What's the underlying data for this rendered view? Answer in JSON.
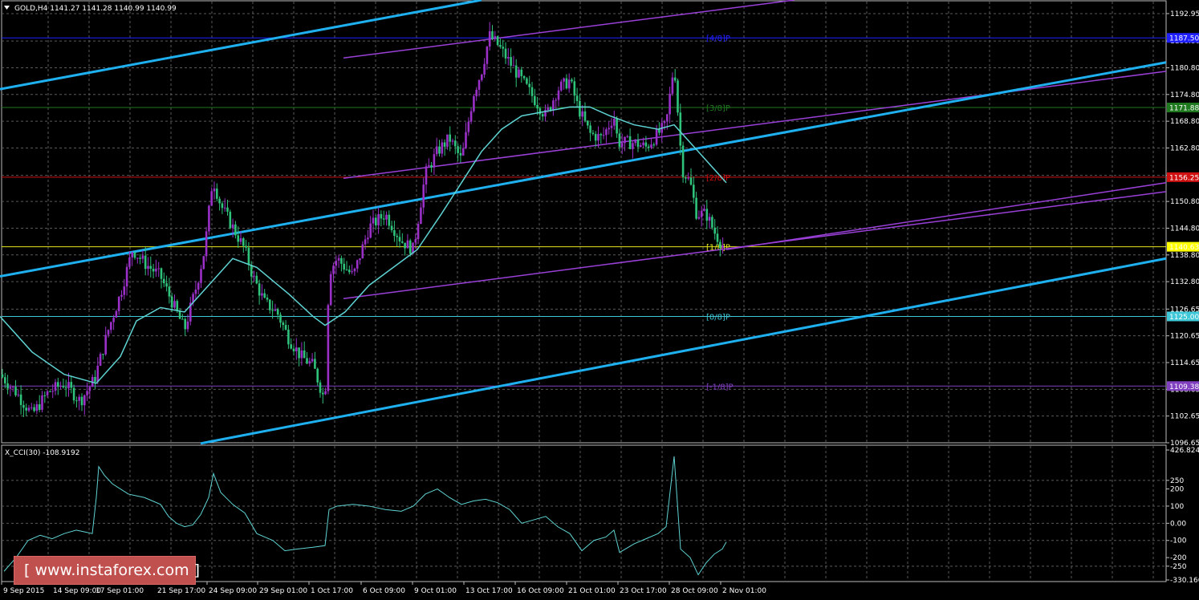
{
  "header": {
    "symbol_label": "GOLD,H4  1141.27 1141.28 1140.99 1140.99"
  },
  "indicator": {
    "label": "X_CCI(30) -108.9192"
  },
  "watermark": {
    "text": "[  www.instaforex.com ]"
  },
  "colors": {
    "background": "#000000",
    "grid": "#5a5a5a",
    "bull": "#9a30c8",
    "bear": "#2ec27a",
    "ma": "#5fd3d3",
    "channel": "#1fb0f0",
    "purple_line": "#9a40d8",
    "cci": "#5fd3d3",
    "watermark_bg": "#c0504d"
  },
  "chart_data": [
    {
      "type": "candlestick",
      "title": "GOLD,H4",
      "ylim": [
        1096.65,
        1196.0
      ],
      "y_ticks": [
        "1192.95",
        "1186.80",
        "1180.80",
        "1174.80",
        "1168.80",
        "1162.80",
        "1156.65",
        "1150.80",
        "1144.80",
        "1138.80",
        "1132.80",
        "1126.65",
        "1120.65",
        "1114.65",
        "1108.65",
        "1102.65",
        "1096.65"
      ],
      "x_tick_labels": [
        "9 Sep 2015",
        "14 Sep 09:00",
        "17 Sep 01:00",
        "21 Sep 17:00",
        "24 Sep 09:00",
        "29 Sep 01:00",
        "1 Oct 17:00",
        "6 Oct 09:00",
        "9 Oct 01:00",
        "13 Oct 17:00",
        "16 Oct 09:00",
        "21 Oct 01:00",
        "23 Oct 17:00",
        "28 Oct 09:00",
        "2 Nov 01:00"
      ],
      "close_path": [
        [
          0,
          1112
        ],
        [
          20,
          1108
        ],
        [
          40,
          1103
        ],
        [
          60,
          1108
        ],
        [
          80,
          1110
        ],
        [
          100,
          1106
        ],
        [
          118,
          1111
        ],
        [
          135,
          1122
        ],
        [
          150,
          1130
        ],
        [
          165,
          1140
        ],
        [
          180,
          1137
        ],
        [
          200,
          1134
        ],
        [
          215,
          1128
        ],
        [
          230,
          1122
        ],
        [
          245,
          1132
        ],
        [
          255,
          1140
        ],
        [
          265,
          1156
        ],
        [
          275,
          1150
        ],
        [
          290,
          1145
        ],
        [
          305,
          1140
        ],
        [
          315,
          1134
        ],
        [
          330,
          1128
        ],
        [
          345,
          1126
        ],
        [
          360,
          1120
        ],
        [
          375,
          1116
        ],
        [
          390,
          1114
        ],
        [
          405,
          1106
        ],
        [
          410,
          1135
        ],
        [
          420,
          1138
        ],
        [
          440,
          1134
        ],
        [
          460,
          1145
        ],
        [
          480,
          1148
        ],
        [
          500,
          1142
        ],
        [
          515,
          1140
        ],
        [
          530,
          1157
        ],
        [
          545,
          1162
        ],
        [
          560,
          1165
        ],
        [
          575,
          1160
        ],
        [
          590,
          1175
        ],
        [
          600,
          1180
        ],
        [
          610,
          1188
        ],
        [
          620,
          1186
        ],
        [
          635,
          1182
        ],
        [
          650,
          1178
        ],
        [
          665,
          1174
        ],
        [
          680,
          1170
        ],
        [
          695,
          1176
        ],
        [
          710,
          1178
        ],
        [
          720,
          1172
        ],
        [
          735,
          1166
        ],
        [
          750,
          1165
        ],
        [
          765,
          1170
        ],
        [
          770,
          1164
        ],
        [
          790,
          1164
        ],
        [
          805,
          1163
        ],
        [
          820,
          1166
        ],
        [
          830,
          1168
        ],
        [
          840,
          1182
        ],
        [
          845,
          1170
        ],
        [
          850,
          1158
        ],
        [
          860,
          1155
        ],
        [
          868,
          1148
        ],
        [
          880,
          1148
        ],
        [
          890,
          1144
        ],
        [
          900,
          1141
        ]
      ],
      "moving_average": [
        [
          0,
          1125
        ],
        [
          40,
          1117
        ],
        [
          80,
          1112
        ],
        [
          120,
          1110
        ],
        [
          150,
          1116
        ],
        [
          170,
          1124
        ],
        [
          200,
          1127
        ],
        [
          230,
          1126
        ],
        [
          260,
          1132
        ],
        [
          290,
          1138
        ],
        [
          320,
          1136
        ],
        [
          360,
          1130
        ],
        [
          390,
          1125
        ],
        [
          405,
          1123
        ],
        [
          430,
          1126
        ],
        [
          460,
          1132
        ],
        [
          490,
          1136
        ],
        [
          520,
          1140
        ],
        [
          550,
          1148
        ],
        [
          575,
          1155
        ],
        [
          600,
          1162
        ],
        [
          625,
          1167
        ],
        [
          650,
          1170
        ],
        [
          680,
          1171
        ],
        [
          710,
          1172
        ],
        [
          735,
          1172
        ],
        [
          760,
          1170
        ],
        [
          790,
          1168
        ],
        [
          820,
          1167
        ],
        [
          840,
          1168
        ],
        [
          860,
          1164
        ],
        [
          880,
          1160
        ],
        [
          905,
          1155
        ]
      ],
      "channel_lines": [
        {
          "from": [
            0,
            1176
          ],
          "to": [
            600,
            1196
          ]
        },
        {
          "from": [
            0,
            1134
          ],
          "to": [
            1453,
            1182
          ]
        },
        {
          "from": [
            250,
            1096.5
          ],
          "to": [
            1453,
            1138
          ]
        }
      ],
      "fan_lines": [
        {
          "from": [
            428,
            1183
          ],
          "to": [
            990,
            1196
          ]
        },
        {
          "from": [
            428,
            1156
          ],
          "to": [
            1453,
            1180
          ]
        },
        {
          "from": [
            428,
            1129
          ],
          "to": [
            1453,
            1153
          ]
        },
        {
          "from": [
            905,
            1140
          ],
          "to": [
            1453,
            1155
          ]
        }
      ],
      "levels": [
        {
          "value": 1187.5,
          "label": "[4/8]P",
          "price_label": "1187.50",
          "color": "#2020ff"
        },
        {
          "value": 1171.88,
          "label": "[3/8]P",
          "price_label": "1171.88",
          "color": "#1f7a1f"
        },
        {
          "value": 1156.25,
          "label": "[2/8]P",
          "price_label": "1156.25",
          "color": "#d01010"
        },
        {
          "value": 1140.63,
          "label": "[1/8]P",
          "price_label": "1140.63",
          "color": "#e8e820"
        },
        {
          "value": 1125.0,
          "label": "[0/8]P",
          "price_label": "1125.00",
          "color": "#3fc8d8"
        },
        {
          "value": 1109.38,
          "label": "[-1/8]P",
          "price_label": "1109.38",
          "color": "#8040c0"
        }
      ]
    },
    {
      "type": "line",
      "title": "X_CCI(30) -108.9192",
      "ylim": [
        -330.1663,
        426.8245
      ],
      "y_ticks": [
        "426.8245",
        "250",
        "200",
        "100",
        "0.00",
        "-100",
        "-200",
        "-250",
        "-330.1663"
      ],
      "series": [
        {
          "name": "X_CCI(30)",
          "values": [
            [
              5,
              -280
            ],
            [
              20,
              -200
            ],
            [
              35,
              -100
            ],
            [
              50,
              -70
            ],
            [
              65,
              -90
            ],
            [
              80,
              -60
            ],
            [
              95,
              -40
            ],
            [
              105,
              -50
            ],
            [
              115,
              -60
            ],
            [
              120,
              150
            ],
            [
              123,
              330
            ],
            [
              130,
              280
            ],
            [
              140,
              230
            ],
            [
              150,
              200
            ],
            [
              160,
              170
            ],
            [
              170,
              160
            ],
            [
              180,
              150
            ],
            [
              190,
              130
            ],
            [
              200,
              110
            ],
            [
              210,
              40
            ],
            [
              220,
              0
            ],
            [
              230,
              -20
            ],
            [
              240,
              -10
            ],
            [
              250,
              50
            ],
            [
              260,
              150
            ],
            [
              266,
              290
            ],
            [
              275,
              180
            ],
            [
              290,
              110
            ],
            [
              305,
              60
            ],
            [
              320,
              -60
            ],
            [
              340,
              -100
            ],
            [
              355,
              -160
            ],
            [
              370,
              -150
            ],
            [
              390,
              -140
            ],
            [
              405,
              -130
            ],
            [
              410,
              80
            ],
            [
              420,
              100
            ],
            [
              440,
              110
            ],
            [
              460,
              100
            ],
            [
              480,
              80
            ],
            [
              500,
              70
            ],
            [
              515,
              100
            ],
            [
              530,
              170
            ],
            [
              545,
              200
            ],
            [
              560,
              150
            ],
            [
              575,
              110
            ],
            [
              590,
              130
            ],
            [
              605,
              140
            ],
            [
              620,
              120
            ],
            [
              635,
              80
            ],
            [
              650,
              0
            ],
            [
              665,
              20
            ],
            [
              680,
              40
            ],
            [
              695,
              -20
            ],
            [
              710,
              -60
            ],
            [
              725,
              -160
            ],
            [
              740,
              -100
            ],
            [
              755,
              -80
            ],
            [
              765,
              -40
            ],
            [
              772,
              -170
            ],
            [
              790,
              -120
            ],
            [
              805,
              -90
            ],
            [
              820,
              -60
            ],
            [
              830,
              -20
            ],
            [
              840,
              390
            ],
            [
              848,
              -150
            ],
            [
              860,
              -200
            ],
            [
              870,
              -300
            ],
            [
              880,
              -230
            ],
            [
              890,
              -180
            ],
            [
              900,
              -150
            ],
            [
              905,
              -109
            ]
          ]
        }
      ]
    }
  ]
}
